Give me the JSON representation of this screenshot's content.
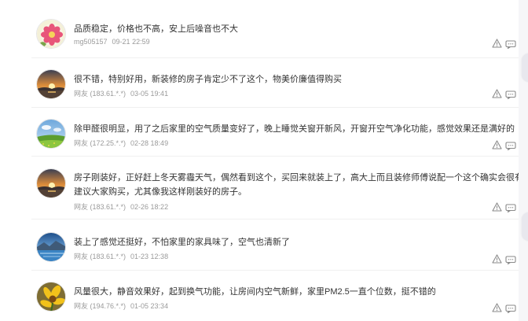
{
  "comments": [
    {
      "avatar": "pink-flower-avatar",
      "text": "品质稳定，价格也不高，安上后噪音也不大",
      "text2": "",
      "user": "mg505157",
      "date": "09-21 22:59"
    },
    {
      "avatar": "sunset-lake-avatar",
      "text": "很不错，特别好用，新装修的房子肯定少不了这个，物美价廉值得购买",
      "text2": "",
      "user": "网友 (183.61.*.*)",
      "date": "03-05 19:41"
    },
    {
      "avatar": "green-field-avatar",
      "text": "除甲醛很明显，用了之后家里的空气质量变好了，晚上睡觉关窗开新风，开窗开空气净化功能，感觉效果还是满好的",
      "text2": "",
      "user": "网友 (172.25.*.*)",
      "date": "02-28 18:49"
    },
    {
      "avatar": "sunset-lake-avatar",
      "text": "房子刚装好，正好赶上冬天雾霾天气，偶然看到这个，买回来就装上了，高大上而且装修师傅说配一个这个确实会很有用处。",
      "text2": "建议大家购买，尤其像我这样刚装好的房子。",
      "user": "网友 (183.61.*.*)",
      "date": "02-26 18:22"
    },
    {
      "avatar": "blue-lake-avatar",
      "text": "装上了感觉还挺好，不怕家里的家具味了，空气也清新了",
      "text2": "",
      "user": "网友 (183.61.*.*)",
      "date": "01-23 12:38"
    },
    {
      "avatar": "yellow-flower-avatar",
      "text": "风量很大，静音效果好，起到换气功能，让房间内空气新鲜，家里PM2.5一直个位数，挺不错的",
      "text2": "",
      "user": "网友 (194.76.*.*)",
      "date": "01-05 23:34"
    }
  ],
  "actions": {
    "report_icon": "warning-triangle-icon",
    "reply_icon": "comment-bubble-icon"
  },
  "colors": {
    "text": "#333333",
    "meta": "#9a9a9a",
    "icon": "#8a8a8a",
    "divider": "#f0f0f0"
  }
}
